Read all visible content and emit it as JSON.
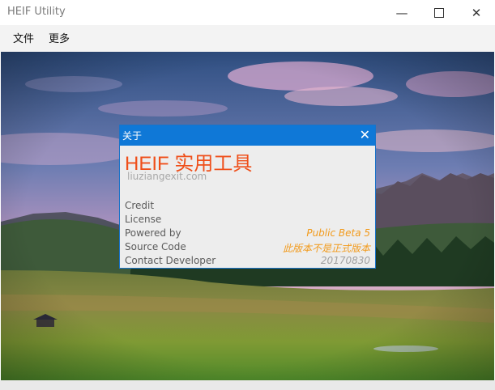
{
  "window": {
    "title": "HEIF Utility"
  },
  "menu": {
    "file": "文件",
    "more": "更多"
  },
  "about": {
    "title": "关于",
    "app_name": "HEIF 实用工具",
    "website": "liuziangexit.com",
    "links": [
      "Credit",
      "License",
      "Powered by",
      "Source Code",
      "Contact Developer"
    ],
    "version_label": "Public Beta 5",
    "notice": "此版本不是正式版本",
    "build": "20170830"
  },
  "colors": {
    "accent": "#0f78d7",
    "app_name": "#ef4f1a",
    "version": "#f29a1b",
    "build": "#a0a0a0"
  }
}
